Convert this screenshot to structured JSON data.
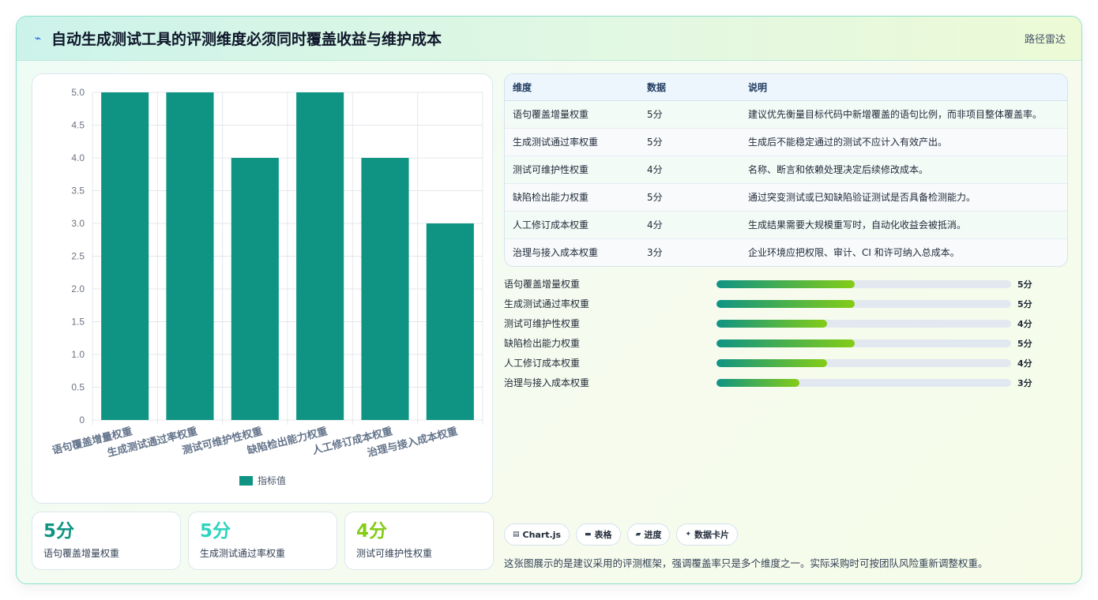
{
  "header": {
    "icon": "trend-icon",
    "title": "自动生成测试工具的评测维度必须同时覆盖收益与维护成本",
    "tag": "路径雷达"
  },
  "chart_data": {
    "type": "bar",
    "categories": [
      "语句覆盖增量权重",
      "生成测试通过率权重",
      "测试可维护性权重",
      "缺陷检出能力权重",
      "人工修订成本权重",
      "治理与接入成本权重"
    ],
    "series": [
      {
        "name": "指标值",
        "values": [
          5,
          5,
          4,
          5,
          4,
          3
        ],
        "color": "#0f9484"
      }
    ],
    "yticks": [
      "0",
      "0.5",
      "1.0",
      "1.5",
      "2.0",
      "2.5",
      "3.0",
      "3.5",
      "4.0",
      "4.5",
      "5.0"
    ],
    "ylim": [
      0,
      5
    ],
    "grid": true,
    "legend": "bottom"
  },
  "table": {
    "headers": [
      "维度",
      "数据",
      "说明"
    ],
    "rows": [
      [
        "语句覆盖增量权重",
        "5分",
        "建议优先衡量目标代码中新增覆盖的语句比例，而非项目整体覆盖率。"
      ],
      [
        "生成测试通过率权重",
        "5分",
        "生成后不能稳定通过的测试不应计入有效产出。"
      ],
      [
        "测试可维护性权重",
        "4分",
        "名称、断言和依赖处理决定后续修改成本。"
      ],
      [
        "缺陷检出能力权重",
        "5分",
        "通过突变测试或已知缺陷验证测试是否具备检测能力。"
      ],
      [
        "人工修订成本权重",
        "4分",
        "生成结果需要大规模重写时，自动化收益会被抵消。"
      ],
      [
        "治理与接入成本权重",
        "3分",
        "企业环境应把权限、审计、CI 和许可纳入总成本。"
      ]
    ]
  },
  "progress": {
    "max": 5,
    "items": [
      {
        "label": "语句覆盖增量权重",
        "value": 5,
        "text": "5分"
      },
      {
        "label": "生成测试通过率权重",
        "value": 5,
        "text": "5分"
      },
      {
        "label": "测试可维护性权重",
        "value": 4,
        "text": "4分"
      },
      {
        "label": "缺陷检出能力权重",
        "value": 5,
        "text": "5分"
      },
      {
        "label": "人工修订成本权重",
        "value": 4,
        "text": "4分"
      },
      {
        "label": "治理与接入成本权重",
        "value": 3,
        "text": "3分"
      }
    ]
  },
  "stats": [
    {
      "value": "5分",
      "label": "语句覆盖增量权重",
      "color": "#0f9484"
    },
    {
      "value": "5分",
      "label": "生成测试通过率权重",
      "color": "#2dd4bf"
    },
    {
      "value": "4分",
      "label": "测试可维护性权重",
      "color": "#84cc16"
    }
  ],
  "chips": [
    {
      "icon": "chart-icon",
      "glyph": "▤",
      "label": "Chart.js"
    },
    {
      "icon": "table-icon",
      "glyph": "▬",
      "label": "表格"
    },
    {
      "icon": "progress-icon",
      "glyph": "▰",
      "label": "进度"
    },
    {
      "icon": "sparkle-icon",
      "glyph": "✦",
      "label": "数据卡片"
    }
  ],
  "footnote": "这张图展示的是建议采用的评测框架，强调覆盖率只是多个维度之一。实际采购时可按团队风险重新调整权重。"
}
